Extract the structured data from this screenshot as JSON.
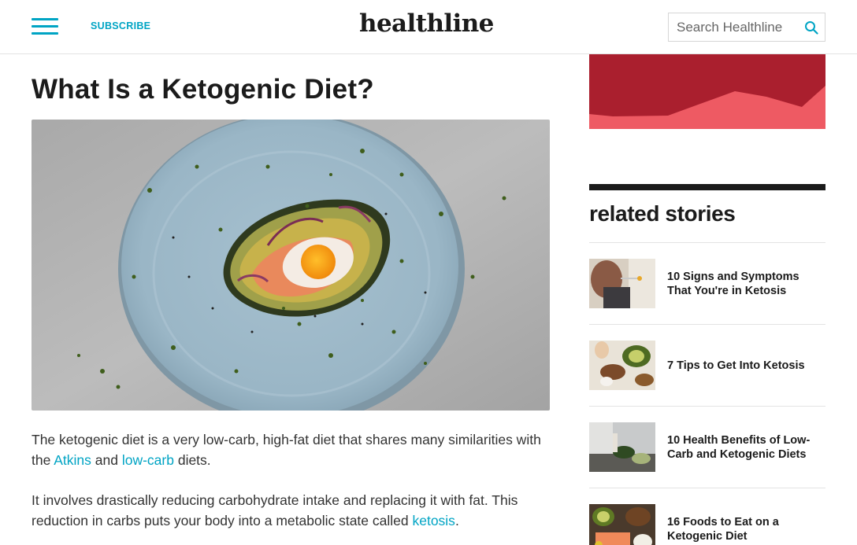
{
  "header": {
    "subscribe_label": "SUBSCRIBE",
    "logo_text": "healthline",
    "search_placeholder": "Search Healthline"
  },
  "article": {
    "title": "What Is a Ketogenic Diet?",
    "hero_image": "avocado baked with egg and salmon on a blue plate",
    "paragraphs": [
      {
        "t1": "The ketogenic diet is a very low-carb, high-fat diet that shares many similarities with the ",
        "link1": "Atkins",
        "t2": " and ",
        "link2": "low-carb",
        "t3": " diets."
      },
      {
        "t1": "It involves drastically reducing carbohydrate intake and replacing it with fat. This reduction in carbs puts your body into a metabolic state called ",
        "link1": "ketosis",
        "t2": "."
      }
    ]
  },
  "sidebar": {
    "related_title": "related stories",
    "items": [
      {
        "label": "10 Signs and Symptoms That You're in Ketosis"
      },
      {
        "label": "7 Tips to Get Into Ketosis"
      },
      {
        "label": "10 Health Benefits of Low-Carb and Ketogenic Diets"
      },
      {
        "label": "16 Foods to Eat on a Ketogenic Diet"
      }
    ]
  },
  "colors": {
    "accent": "#00a4c4",
    "ad_dark": "#aa1f2e",
    "ad_light": "#ee5a63",
    "text": "#1b1b1b"
  }
}
